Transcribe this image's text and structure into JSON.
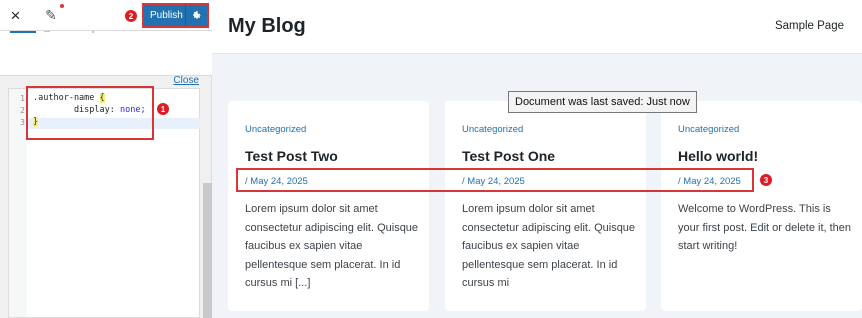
{
  "customizer": {
    "close_icon": "×",
    "edit_icon": "✎",
    "publish_label": "Publish",
    "gear_icon": "gear-icon",
    "close_link": "Close",
    "code_lines": [
      {
        "num": "1",
        "selector": ".author-name ",
        "brace": "{"
      },
      {
        "num": "2",
        "property": "        display:",
        "value": " none;"
      },
      {
        "num": "3",
        "brace": "}"
      }
    ]
  },
  "markers": {
    "m1": "1",
    "m2": "2",
    "m3": "3"
  },
  "site": {
    "title": "My Blog",
    "nav_link": "Sample Page",
    "tooltip": "Document was last saved: Just now"
  },
  "posts": [
    {
      "category": "Uncategorized",
      "title": "Test Post Two",
      "date": "/ May 24, 2025",
      "excerpt": "Lorem ipsum dolor sit amet consectetur adipiscing elit. Quisque faucibus ex sapien vitae pellentesque sem placerat. In id cursus mi [...]"
    },
    {
      "category": "Uncategorized",
      "title": "Test Post One",
      "date": "/ May 24, 2025",
      "excerpt": "Lorem ipsum dolor sit amet consectetur adipiscing elit. Quisque faucibus ex sapien vitae pellentesque sem placerat. In id cursus mi"
    },
    {
      "category": "Uncategorized",
      "title": "Hello world!",
      "date": "/ May 24, 2025",
      "excerpt": "Welcome to WordPress. This is your first post. Edit or delete it, then start writing!"
    }
  ],
  "colors": {
    "accent": "#2271b1",
    "highlight_red": "#d63638"
  }
}
